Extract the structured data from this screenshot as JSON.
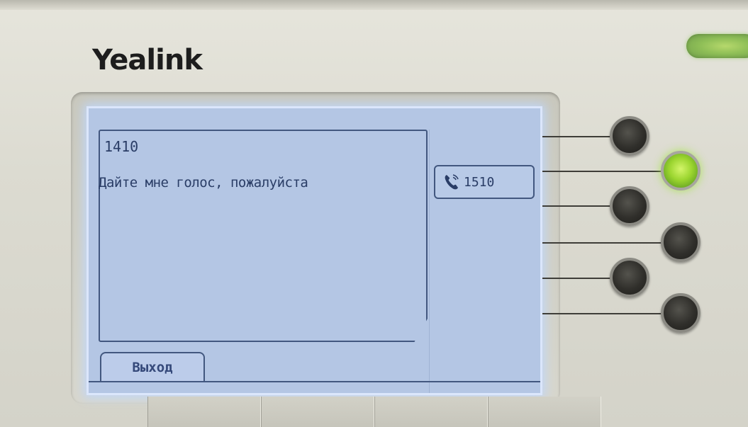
{
  "device": {
    "brand": "Yealink"
  },
  "screen": {
    "message": {
      "sender": "1410",
      "text": "Дайте мне голос, пожалуйста"
    },
    "line_key": {
      "label": "1510",
      "icon": "phone-handset-icon"
    },
    "softkeys": [
      {
        "label": "Выход"
      }
    ]
  },
  "hardware": {
    "line_buttons_lit": [
      false,
      true,
      false,
      false,
      false,
      false
    ],
    "power_led_color": "#8fbf57",
    "lit_button_color": "#9bd52f"
  }
}
